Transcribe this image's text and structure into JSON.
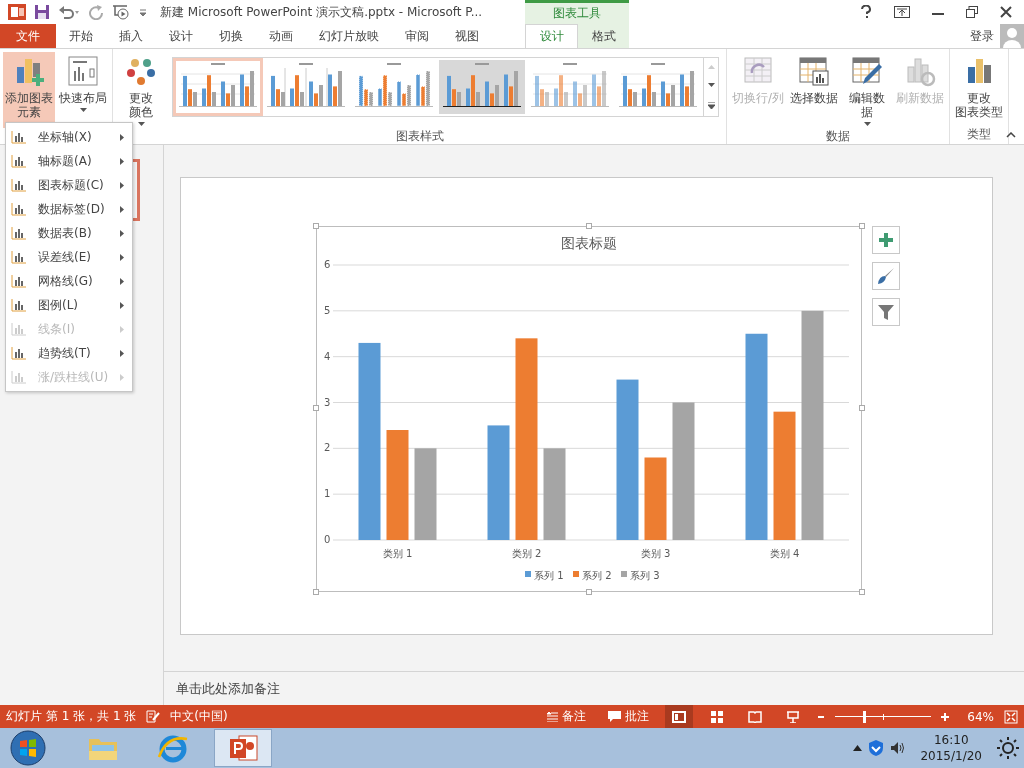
{
  "title_bar": {
    "title": "新建 Microsoft PowerPoint 演示文稿.pptx - Microsoft P...",
    "context_group": "图表工具",
    "sign_in": "登录"
  },
  "tabs": [
    {
      "label": "文件",
      "kind": "file",
      "selected": false
    },
    {
      "label": "开始",
      "kind": "main",
      "selected": false
    },
    {
      "label": "插入",
      "kind": "main",
      "selected": false
    },
    {
      "label": "设计",
      "kind": "main",
      "selected": false
    },
    {
      "label": "切换",
      "kind": "main",
      "selected": false
    },
    {
      "label": "动画",
      "kind": "main",
      "selected": false
    },
    {
      "label": "幻灯片放映",
      "kind": "main",
      "selected": false
    },
    {
      "label": "审阅",
      "kind": "main",
      "selected": false
    },
    {
      "label": "视图",
      "kind": "main",
      "selected": false
    },
    {
      "label": "设计",
      "kind": "context",
      "selected": true
    },
    {
      "label": "格式",
      "kind": "context",
      "selected": false
    }
  ],
  "ribbon": {
    "groups": [
      {
        "buttons": [
          {
            "lines": [
              "添加图表",
              "元素"
            ],
            "kind": "add-element",
            "dropdown": true,
            "disabled": false,
            "selected": true
          },
          {
            "lines": [
              "快速布局"
            ],
            "kind": "layout",
            "dropdown": true,
            "disabled": false,
            "selected": false
          }
        ]
      },
      {
        "label": "图表样式",
        "buttons": [
          {
            "lines": [
              "更改",
              "颜色"
            ],
            "kind": "colors",
            "dropdown": true,
            "disabled": false,
            "selected": false
          }
        ],
        "styles": [
          {
            "kind": "plain",
            "selected": true
          },
          {
            "kind": "lined",
            "selected": false
          },
          {
            "kind": "striped",
            "selected": false
          },
          {
            "kind": "shaded",
            "selected": false
          },
          {
            "kind": "light",
            "selected": false
          },
          {
            "kind": "plain",
            "selected": false
          }
        ]
      },
      {
        "label": "数据",
        "buttons": [
          {
            "lines": [
              "切换行/列"
            ],
            "kind": "switch",
            "dropdown": false,
            "disabled": true,
            "selected": false
          },
          {
            "lines": [
              "选择数据"
            ],
            "kind": "select-data",
            "dropdown": false,
            "disabled": false,
            "selected": false
          },
          {
            "lines": [
              "编辑数",
              "据"
            ],
            "kind": "edit-data",
            "dropdown": true,
            "disabled": false,
            "selected": false
          },
          {
            "lines": [
              "刷新数据"
            ],
            "kind": "refresh",
            "dropdown": false,
            "disabled": true,
            "selected": false
          }
        ]
      },
      {
        "label": "类型",
        "buttons": [
          {
            "lines": [
              "更改",
              "图表类型"
            ],
            "kind": "chart-type",
            "dropdown": false,
            "disabled": false,
            "selected": false
          }
        ]
      }
    ]
  },
  "element_menu": {
    "items": [
      {
        "label": "坐标轴(X)",
        "disabled": false
      },
      {
        "label": "轴标题(A)",
        "disabled": false
      },
      {
        "label": "图表标题(C)",
        "disabled": false
      },
      {
        "label": "数据标签(D)",
        "disabled": false
      },
      {
        "label": "数据表(B)",
        "disabled": false
      },
      {
        "label": "误差线(E)",
        "disabled": false
      },
      {
        "label": "网格线(G)",
        "disabled": false
      },
      {
        "label": "图例(L)",
        "disabled": false
      },
      {
        "label": "线条(I)",
        "disabled": true
      },
      {
        "label": "趋势线(T)",
        "disabled": false
      },
      {
        "label": "涨/跌柱线(U)",
        "disabled": true
      }
    ]
  },
  "slide": {
    "chart_data": {
      "type": "bar",
      "title": "图表标题",
      "categories": [
        "类别 1",
        "类别 2",
        "类别 3",
        "类别 4"
      ],
      "series": [
        {
          "name": "系列 1",
          "color": "#5b9bd5",
          "values": [
            4.3,
            2.5,
            3.5,
            4.5
          ]
        },
        {
          "name": "系列 2",
          "color": "#ed7d31",
          "values": [
            2.4,
            4.4,
            1.8,
            2.8
          ]
        },
        {
          "name": "系列 3",
          "color": "#a5a5a5",
          "values": [
            2,
            2,
            3,
            5
          ]
        }
      ],
      "ylim": [
        0,
        6
      ],
      "yticks": [
        0,
        1,
        2,
        3,
        4,
        5,
        6
      ],
      "grid": true,
      "legend": "bottom"
    }
  },
  "notes": {
    "placeholder": "单击此处添加备注"
  },
  "status_bar": {
    "slide_info": "幻灯片 第 1 张，共 1 张",
    "language": "中文(中国)",
    "notes_button": "备注",
    "comments_button": "批注",
    "views": [
      {
        "kind": "normal",
        "selected": true
      },
      {
        "kind": "sorter",
        "selected": false
      },
      {
        "kind": "reading",
        "selected": false
      },
      {
        "kind": "slideshow",
        "selected": false
      }
    ],
    "zoom": {
      "level": 0.3,
      "reading": "64%"
    }
  },
  "taskbar": {
    "apps": [
      {
        "kind": "explorer",
        "active": false
      },
      {
        "kind": "browser",
        "active": false
      },
      {
        "kind": "presentation",
        "active": true
      }
    ],
    "time": "16:10",
    "date": "2015/1/20"
  }
}
